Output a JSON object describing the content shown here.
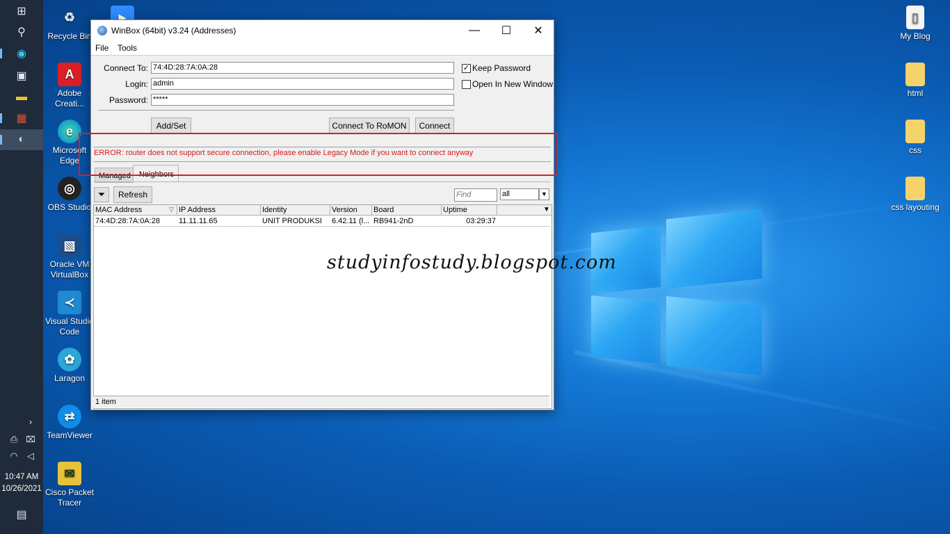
{
  "taskbar": {
    "icons": [
      "windows-start-icon",
      "search-icon",
      "edge-icon",
      "store-icon",
      "file-explorer-icon",
      "office-icon",
      "winbox-icon"
    ],
    "time": "10:47 AM",
    "date": "10/26/2021"
  },
  "desktop_left": [
    {
      "label": "Recycle Bin",
      "icon": "recycle-bin-icon"
    },
    {
      "label": "Adobe Creati...",
      "icon": "adobe-creative-cloud-icon"
    },
    {
      "label": "Microsoft Edge",
      "icon": "edge-icon"
    },
    {
      "label": "OBS Studio",
      "icon": "obs-icon"
    },
    {
      "label": "Oracle VM VirtualBox",
      "icon": "virtualbox-icon"
    },
    {
      "label": "Visual Studio Code",
      "icon": "vscode-icon"
    },
    {
      "label": "Laragon",
      "icon": "laragon-icon"
    },
    {
      "label": "TeamViewer",
      "icon": "teamviewer-icon"
    },
    {
      "label": "Cisco Packet Tracer",
      "icon": "packet-tracer-icon"
    }
  ],
  "desktop_right": [
    {
      "label": "My Blog",
      "icon": "document-icon"
    },
    {
      "label": "html",
      "icon": "folder-icon"
    },
    {
      "label": "css",
      "icon": "folder-icon"
    },
    {
      "label": "css layouting",
      "icon": "folder-icon"
    }
  ],
  "window": {
    "title": "WinBox (64bit) v3.24 (Addresses)",
    "menu": [
      "File",
      "Tools"
    ],
    "connect_to_label": "Connect To:",
    "connect_to_value": "74:4D:28:7A:0A:28",
    "login_label": "Login:",
    "login_value": "admin",
    "password_label": "Password:",
    "password_value": "*****",
    "keep_password_label": "Keep Password",
    "keep_password_checked": true,
    "open_new_window_label": "Open In New Window",
    "open_new_window_checked": false,
    "add_set_label": "Add/Set",
    "romon_label": "Connect To RoMON",
    "connect_label": "Connect",
    "error_text": "ERROR: router does not support secure connection, please enable Legacy Mode if you want to connect anyway",
    "tabs": [
      "Managed",
      "Neighbors"
    ],
    "refresh_label": "Refresh",
    "find_placeholder": "Find",
    "filter_value": "all",
    "columns": [
      "MAC Address",
      "IP Address",
      "Identity",
      "Version",
      "Board",
      "Uptime"
    ],
    "rows": [
      [
        "74:4D:28:7A:0A:28",
        "11.11.11.65",
        "UNIT PRODUKSI",
        "6.42.11 (l...",
        "RB941-2nD",
        "03:29:37"
      ]
    ],
    "status": "1 item"
  },
  "watermark": "studyinfostudy.blogspot.com",
  "colors": {
    "error": "#d61a1a",
    "highlight_box": "#d2202a",
    "taskbar": "#1f2b3a"
  }
}
